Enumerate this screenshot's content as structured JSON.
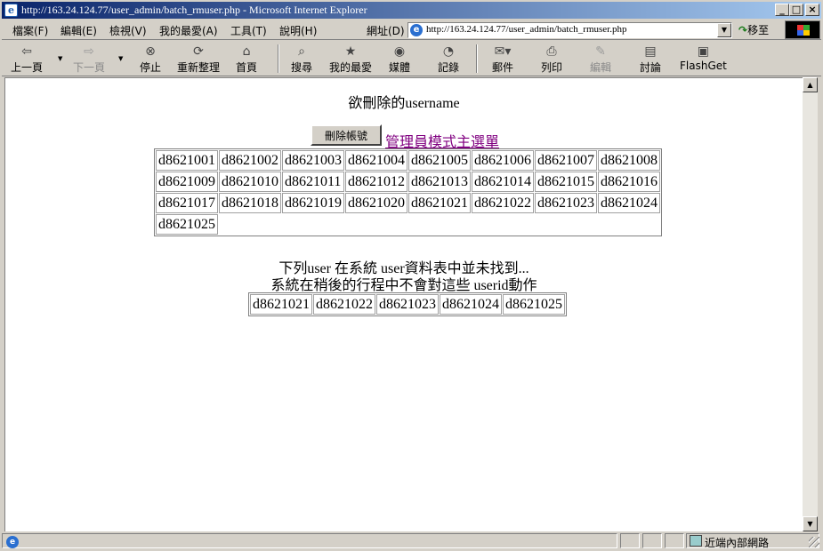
{
  "window": {
    "title": "http://163.24.124.77/user_admin/batch_rmuser.php - Microsoft Internet Explorer"
  },
  "menu": {
    "items": [
      "檔案(F)",
      "編輯(E)",
      "檢視(V)",
      "我的最愛(A)",
      "工具(T)",
      "說明(H)"
    ],
    "address_label": "網址(D)",
    "address_value": "http://163.24.124.77/user_admin/batch_rmuser.php",
    "go_label": "移至"
  },
  "toolbar": {
    "back": "上一頁",
    "forward": "下一頁",
    "stop": "停止",
    "refresh": "重新整理",
    "home": "首頁",
    "search": "搜尋",
    "favorites": "我的最愛",
    "media": "媒體",
    "history": "記錄",
    "mail": "郵件",
    "print": "列印",
    "edit": "編輯",
    "discuss": "討論",
    "flashget": "FlashGet"
  },
  "page": {
    "heading": "欲刪除的username",
    "delete_button": "刪除帳號",
    "admin_link": "管理員模式主選單",
    "users": [
      [
        "d8621001",
        "d8621002",
        "d8621003",
        "d8621004",
        "d8621005",
        "d8621006",
        "d8621007",
        "d8621008"
      ],
      [
        "d8621009",
        "d8621010",
        "d8621011",
        "d8621012",
        "d8621013",
        "d8621014",
        "d8621015",
        "d8621016"
      ],
      [
        "d8621017",
        "d8621018",
        "d8621019",
        "d8621020",
        "d8621021",
        "d8621022",
        "d8621023",
        "d8621024"
      ],
      [
        "d8621025"
      ]
    ],
    "notice_line1": "下列user 在系統 user資料表中並未找到...",
    "notice_line2": "系統在稍後的行程中不會對這些 userid動作",
    "not_found": [
      "d8621021",
      "d8621022",
      "d8621023",
      "d8621024",
      "d8621025"
    ]
  },
  "status": {
    "zone": "近端內部網路"
  },
  "icons": {
    "title": "ie-page-icon",
    "address": "ie-page-icon",
    "go": "go-arrow-icon",
    "status": "ie-page-icon",
    "zone": "intranet-zone-icon"
  }
}
